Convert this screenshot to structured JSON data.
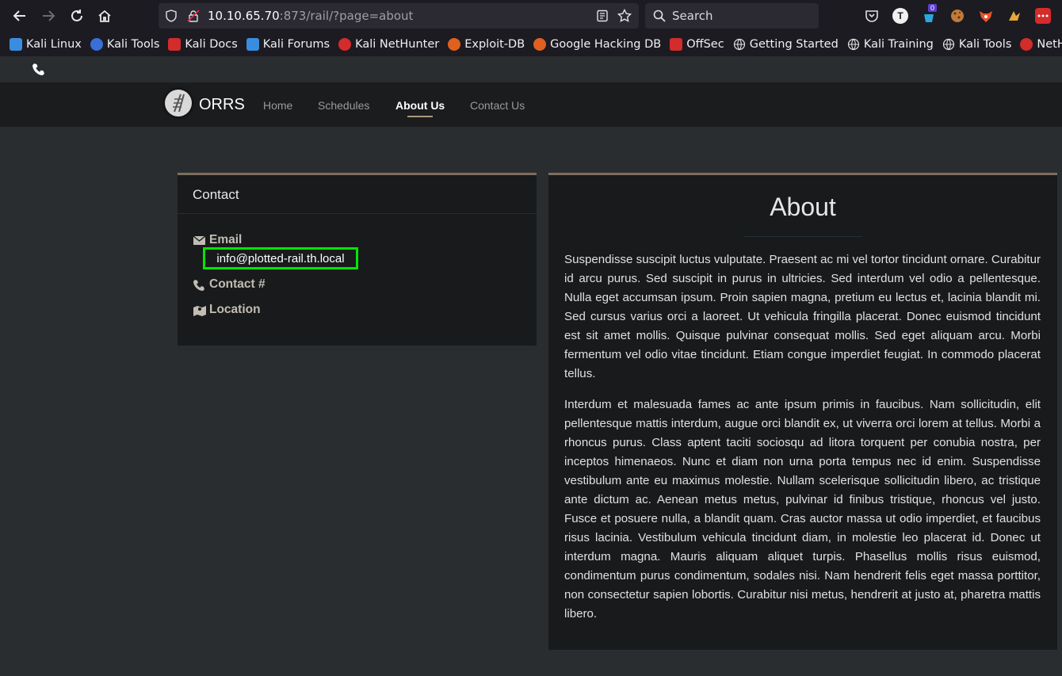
{
  "browser": {
    "url_host": "10.10.65.70",
    "url_path": ":873/rail/?page=about",
    "search_placeholder": "Search",
    "badge_count": "0"
  },
  "bookmarks": [
    {
      "label": "Kali Linux",
      "color": "#3a8dde"
    },
    {
      "label": "Kali Tools",
      "color": "#3a6fd8"
    },
    {
      "label": "Kali Docs",
      "color": "#d42b2b"
    },
    {
      "label": "Kali Forums",
      "color": "#3a8dde"
    },
    {
      "label": "Kali NetHunter",
      "color": "#d42b2b"
    },
    {
      "label": "Exploit-DB",
      "color": "#e0601f"
    },
    {
      "label": "Google Hacking DB",
      "color": "#e0601f"
    },
    {
      "label": "OffSec",
      "color": "#d42b2b"
    },
    {
      "label": "Getting Started",
      "color": "#ffffff"
    },
    {
      "label": "Kali Training",
      "color": "#ffffff"
    },
    {
      "label": "Kali Tools",
      "color": "#ffffff"
    },
    {
      "label": "NetHunter",
      "color": "#d42b2b"
    }
  ],
  "site": {
    "brand": "ORRS",
    "nav": [
      "Home",
      "Schedules",
      "About Us",
      "Contact Us"
    ],
    "active_nav": "About Us"
  },
  "contact": {
    "title": "Contact",
    "email_label": "Email",
    "email_value": "info@plotted-rail.th.local",
    "phone_label": "Contact #",
    "location_label": "Location"
  },
  "about": {
    "title": "About",
    "paragraph1": "Suspendisse suscipit luctus vulputate. Praesent ac mi vel tortor tincidunt ornare. Curabitur id arcu purus. Sed suscipit in purus in ultricies. Sed interdum vel odio a pellentesque. Nulla eget accumsan ipsum. Proin sapien magna, pretium eu lectus et, lacinia blandit mi. Sed cursus varius orci a laoreet. Ut vehicula fringilla placerat. Donec euismod tincidunt est sit amet mollis. Quisque pulvinar consequat mollis. Sed eget aliquam arcu. Morbi fermentum vel odio vitae tincidunt. Etiam congue imperdiet feugiat. In commodo placerat tellus.",
    "paragraph2": "Interdum et malesuada fames ac ante ipsum primis in faucibus. Nam sollicitudin, elit pellentesque mattis interdum, augue orci blandit ex, ut viverra orci lorem at tellus. Morbi a rhoncus purus. Class aptent taciti sociosqu ad litora torquent per conubia nostra, per inceptos himenaeos. Nunc et diam non urna porta tempus nec id enim. Suspendisse vestibulum ante eu maximus molestie. Nullam scelerisque sollicitudin libero, ac tristique ante dictum ac. Aenean metus metus, pulvinar id finibus tristique, rhoncus vel justo. Fusce et posuere nulla, a blandit quam. Cras auctor massa ut odio imperdiet, et faucibus risus lacinia. Vestibulum vehicula tincidunt diam, in molestie leo placerat id. Donec ut interdum magna. Mauris aliquam aliquet turpis. Phasellus mollis risus euismod, condimentum purus condimentum, sodales nisi. Nam hendrerit felis eget massa porttitor, non consectetur sapien lobortis. Curabitur nisi metus, hendrerit at justo at, pharetra mattis libero."
  },
  "colors": {
    "highlight_box": "#00e600",
    "accent": "#7c6e5b"
  }
}
